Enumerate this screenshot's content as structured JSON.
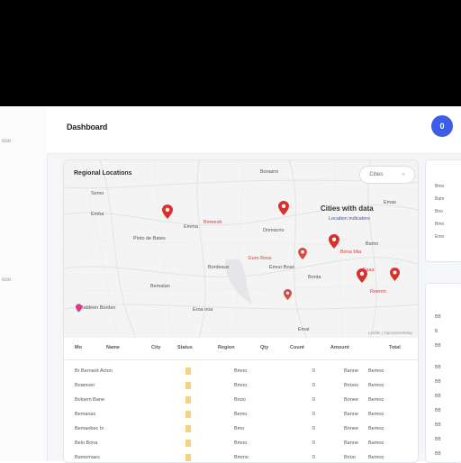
{
  "sidebar": {
    "items": [
      {
        "label": "ooo"
      },
      {
        "label": "ooo"
      }
    ]
  },
  "header": {
    "title": "Dashboard",
    "avatar_initial": "0"
  },
  "map": {
    "title": "Regional Locations",
    "control_label": "Cities",
    "location_title": "Cities with data",
    "legend_label": "Location indicators",
    "attribution": "Leaflet | OpenStreetMap",
    "labels": {
      "l1": "Pinto de Bates",
      "l2": "Bmeeob",
      "l3": "Emas",
      "l4": "Bordeaux",
      "l5": "Dnmacrio",
      "l6": "Remeum",
      "l7": "Bona Mia",
      "l8": "Euro Ross",
      "l9": "Baldeen Borden",
      "l10": "Lorem Ipsum",
      "l11": "Bonaimi",
      "l12": "Emoo Boac",
      "l13": "Eroa ooa",
      "l14": "Lemans",
      "l15": "Bemalan",
      "l16": "Emba",
      "l17": "Emma",
      "l18": "Bamo",
      "l19": "Esaa",
      "l20": "Bonta",
      "l21": "Reemn",
      "l22": "Semo",
      "l23": "Emal"
    }
  },
  "table": {
    "headers": [
      "Mo",
      "Name",
      "City",
      "Status",
      "Region",
      "Qty",
      "Count",
      "Amount",
      "Total"
    ],
    "rows": [
      {
        "name": "Br Bernard Acton",
        "status": "Bmoo",
        "count": "0",
        "amount": "Banne",
        "total": "Bemoo"
      },
      {
        "name": "Boamoer",
        "status": "Bmoo",
        "count": "0",
        "amount": "Bnooo",
        "total": "Bemoo"
      },
      {
        "name": "Boloem Bane",
        "status": "Bnoo",
        "count": "0",
        "amount": "Bonee",
        "total": "Bemoo"
      },
      {
        "name": "Bemanas",
        "status": "Bemo",
        "count": "0",
        "amount": "Banne",
        "total": "Bemoo"
      },
      {
        "name": "Bemanbec In",
        "status": "Bmo",
        "count": "0",
        "amount": "Bnnee",
        "total": "Bemoo"
      },
      {
        "name": "Belo Bona",
        "status": "Bmoo",
        "count": "0",
        "amount": "Banne",
        "total": "Bamoo"
      },
      {
        "name": "Bamemaes",
        "status": "Bmmo",
        "count": "0",
        "amount": "Bnoo",
        "total": "Bemoo"
      }
    ]
  },
  "right_card": {
    "lines": [
      "Bmo",
      "Bam",
      "Bno",
      "Bmo",
      "Emo"
    ],
    "list": [
      "BB",
      "B",
      "BB",
      "BB",
      "BB",
      "BB",
      "BB",
      "BB",
      "BB",
      "BB"
    ]
  }
}
